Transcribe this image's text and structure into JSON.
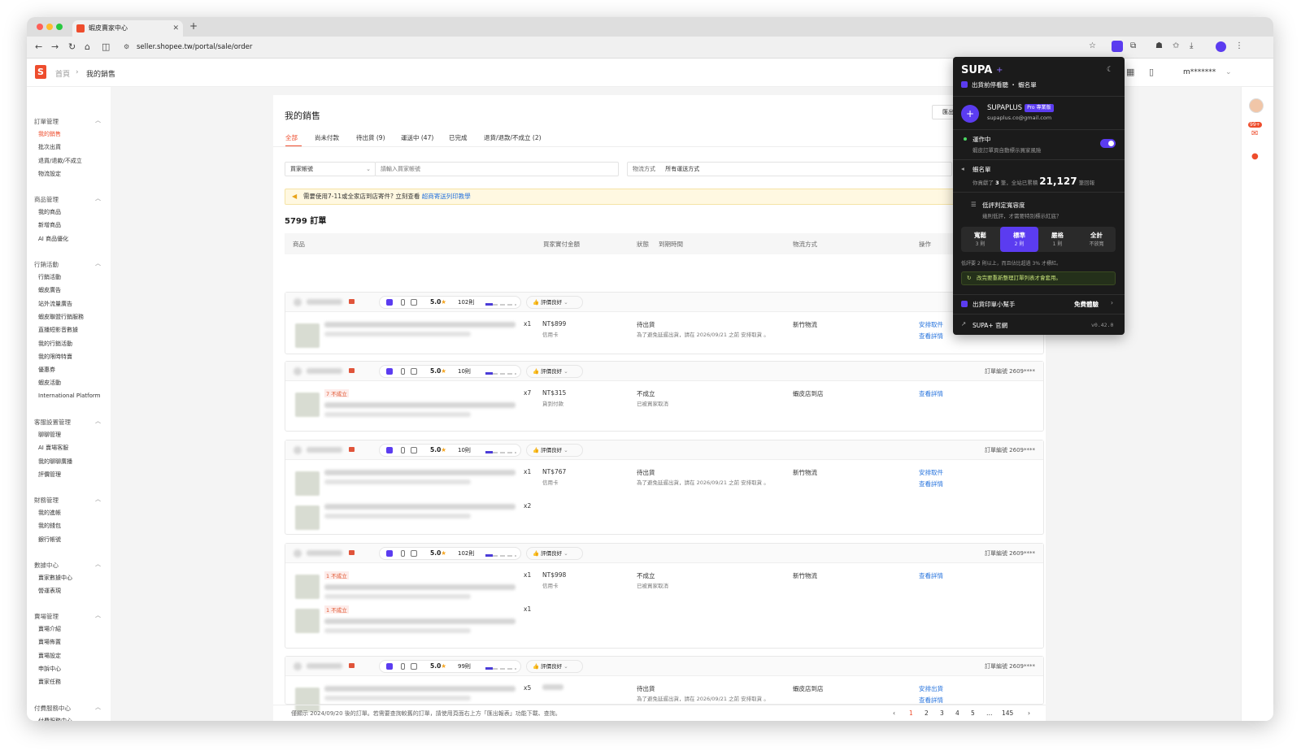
{
  "browser": {
    "tab_title": "蝦皮賣家中心",
    "url": "seller.shopee.tw/portal/sale/order"
  },
  "header": {
    "breadcrumb": [
      "首頁",
      "我的銷售"
    ],
    "user": "m*******"
  },
  "sidebar": {
    "sections": [
      {
        "title": "訂單管理",
        "items": [
          "我的銷售",
          "批次出貨",
          "退貨/退款/不成立",
          "物流設定"
        ]
      },
      {
        "title": "商品管理",
        "items": [
          "我的商品",
          "新增商品",
          "AI 商品優化"
        ]
      },
      {
        "title": "行銷活動",
        "items": [
          "行銷活動",
          "蝦皮廣告",
          "站外流量廣告",
          "蝦皮聯盟行銷服務",
          "直播短影音數據",
          "我的行銷活動",
          "我的限時特賣",
          "優惠券",
          "蝦皮活動",
          "International Platform"
        ]
      },
      {
        "title": "客服設置管理",
        "items": [
          "聊聊管理",
          "AI 賣場客服",
          "我的聊聊廣播",
          "評價管理"
        ]
      },
      {
        "title": "財務管理",
        "items": [
          "我的進帳",
          "我的錢包",
          "銀行帳號"
        ]
      },
      {
        "title": "數據中心",
        "items": [
          "賣家數據中心",
          "營運表現"
        ]
      },
      {
        "title": "賣場管理",
        "items": [
          "賣場介紹",
          "賣場佈置",
          "賣場設定",
          "申訴中心",
          "賣家任務"
        ]
      },
      {
        "title": "付費服務中心",
        "items": [
          "付費服務中心"
        ]
      }
    ]
  },
  "main": {
    "title": "我的銷售",
    "export_label": "匯出",
    "tabs": [
      "全部",
      "尚未付款",
      "待出貨 (9)",
      "運送中 (47)",
      "已完成",
      "退貨/退款/不成立 (2)"
    ],
    "filter_buyer": "買家帳號",
    "filter_buyer_placeholder": "請輸入買家帳號",
    "filter_ship_label": "物流方式",
    "filter_ship_value": "所有運送方式",
    "notice": "需要使用7-11或全家店到店寄件? 立刻查看",
    "notice_link": "超商寄送列印教學",
    "order_count": "5799 訂單",
    "columns": [
      "商品",
      "買家實付金額",
      "狀態",
      "到期時間",
      "物流方式",
      "操作"
    ],
    "review_label": "評價良好",
    "orders": [
      {
        "score": "5.0",
        "count": "102則",
        "id": "",
        "qty1": "x1",
        "qty2": "",
        "tag1": "",
        "tag2": "",
        "price": "NT$899",
        "pay": "信用卡",
        "status": "待出貨",
        "status_note": "為了避免延遲出貨，請在 2026/09/21 之前 安排取貨 。",
        "ship": "新竹物流",
        "action1": "安排取件",
        "action2": "查看詳情"
      },
      {
        "score": "5.0",
        "count": "10則",
        "id": "訂單編號 2609****",
        "qty1": "x7",
        "qty2": "",
        "tag1": "7 不成立",
        "tag2": "",
        "price": "NT$315",
        "pay": "貨到付款",
        "status": "不成立",
        "status_note": "已被買家取消",
        "ship": "蝦皮店到店",
        "action1": "查看詳情",
        "action2": ""
      },
      {
        "score": "5.0",
        "count": "10則",
        "id": "訂單編號 2609****",
        "qty1": "x1",
        "qty2": "x2",
        "tag1": "",
        "tag2": "",
        "price": "NT$767",
        "pay": "信用卡",
        "status": "待出貨",
        "status_note": "為了避免延遲出貨，請在 2026/09/21 之前 安排取貨 。",
        "ship": "新竹物流",
        "action1": "安排取件",
        "action2": "查看詳情"
      },
      {
        "score": "5.0",
        "count": "102則",
        "id": "訂單編號 2609****",
        "qty1": "x1",
        "qty2": "x1",
        "tag1": "1 不成立",
        "tag2": "1 不成立",
        "price": "NT$998",
        "pay": "信用卡",
        "status": "不成立",
        "status_note": "已被買家取消",
        "ship": "新竹物流",
        "action1": "查看詳情",
        "action2": ""
      },
      {
        "score": "5.0",
        "count": "99則",
        "id": "訂單編號 2609****",
        "qty1": "x5",
        "qty2": "",
        "tag1": "",
        "tag2": "",
        "price": "",
        "pay": "",
        "status": "待出貨",
        "status_note": "為了避免延遲出貨，請在 2026/09/21 之前 安排取貨 。",
        "ship": "蝦皮店到店",
        "action1": "安排出貨",
        "action2": "查看詳情"
      }
    ],
    "footer_msg": "僅顯示 2024/09/20 後的訂單。若需要查詢較舊的訂單，請使用頁面右上方「匯出報表」功能下載、查詢。",
    "pages": [
      "1",
      "2",
      "3",
      "4",
      "5",
      "…",
      "145"
    ]
  },
  "panel": {
    "brand": "SUPA",
    "subtitle": "出貨前停看聽 ・ 蝦名單",
    "account_name": "SUPAPLUS",
    "account_badge": "Pro 專業版",
    "account_email": "supaplus.co@gmail.com",
    "running_title": "運作中",
    "running_desc": "蝦皮訂單頁自動標示買家風險",
    "blacklist_title": "蝦名單",
    "blacklist_desc_a": "你貢獻了",
    "blacklist_mine": "3",
    "blacklist_desc_b": "筆，全站已累積",
    "blacklist_total": "21,127",
    "blacklist_desc_c": "筆回報",
    "tolerance_title": "低評判定寬容度",
    "tolerance_desc": "幾則低評，才需要特別標示紅底？",
    "levels": [
      {
        "name": "寬鬆",
        "sub": "3 則"
      },
      {
        "name": "標準",
        "sub": "2 則"
      },
      {
        "name": "嚴格",
        "sub": "1 則"
      },
      {
        "name": "全計",
        "sub": "不放寬"
      }
    ],
    "level_note": "低評要 2 則以上，而且佔比超過 3% 才標紅。",
    "refresh_note": "改完要重新整理訂單列表才會套用。",
    "helper_title": "出貨印單小幫手",
    "helper_action": "免費體驗",
    "site_link": "SUPA+ 官網",
    "version": "v0.42.0"
  },
  "right_badge": "99+",
  "colors": {
    "accent": "#ee4d2d",
    "link": "#2673dd",
    "panel_purple": "#5b3cf0"
  }
}
